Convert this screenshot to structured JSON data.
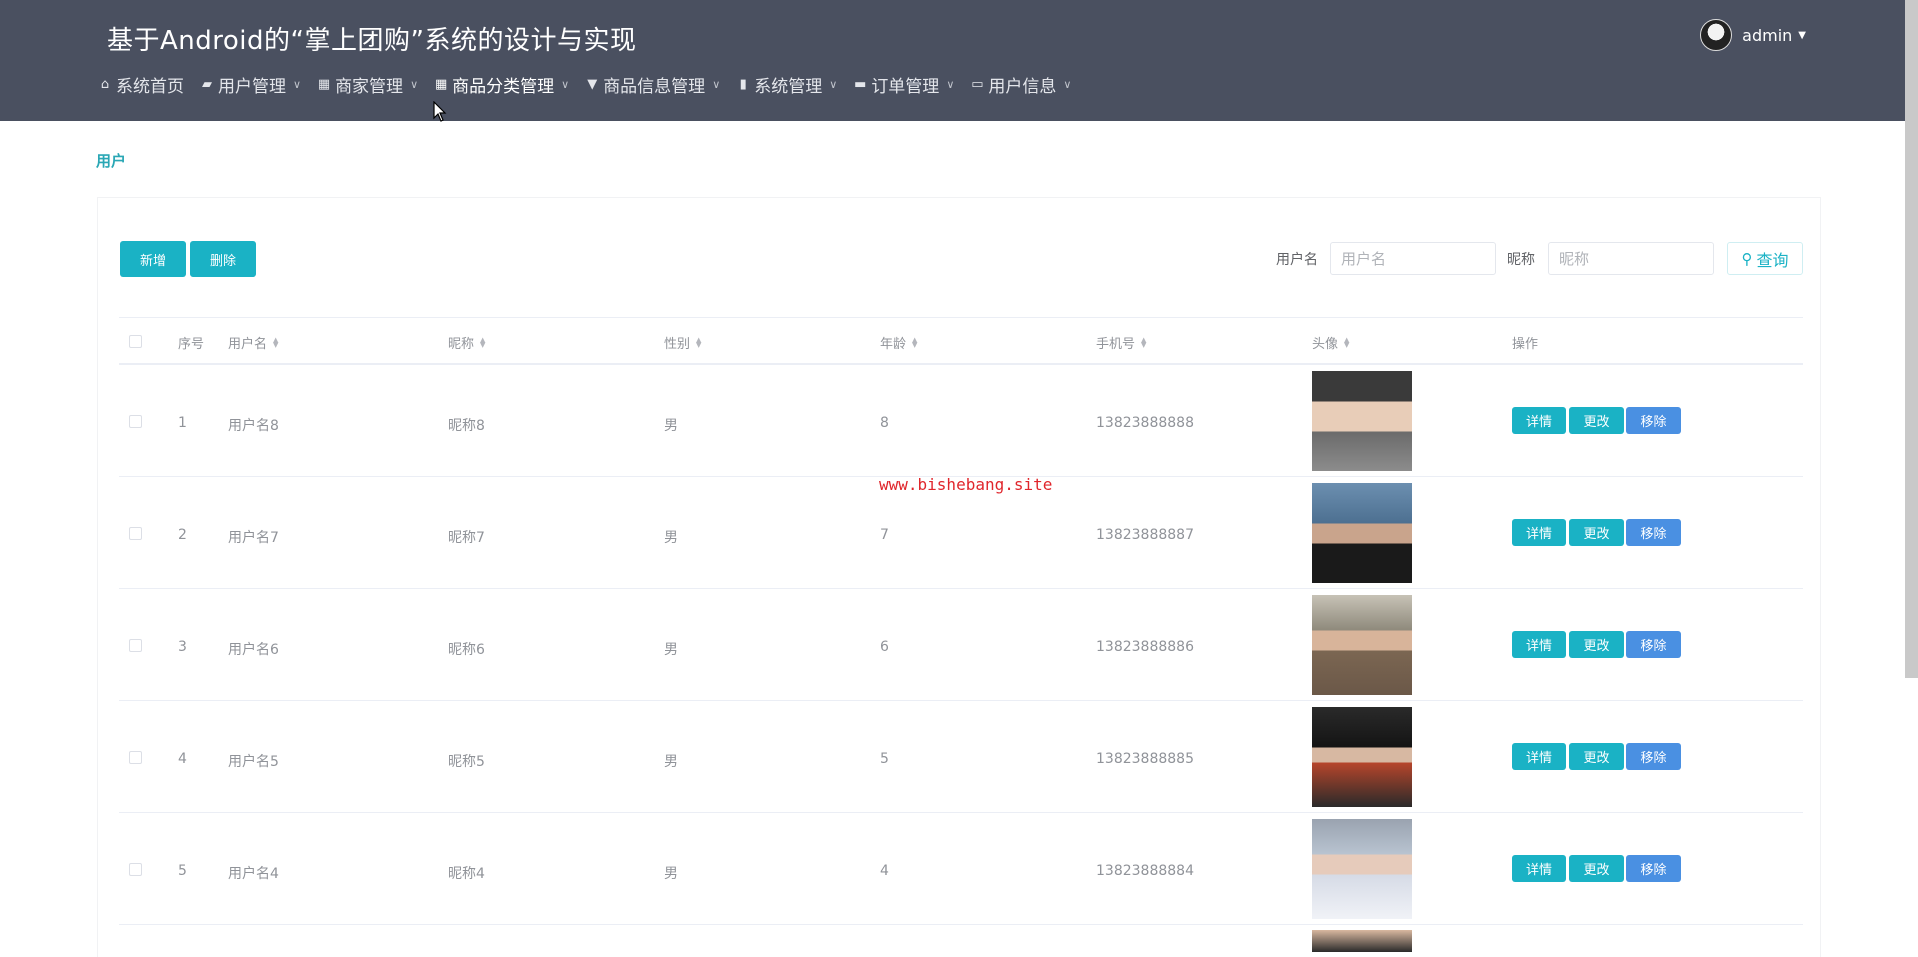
{
  "header": {
    "title": "基于Android的“掌上团购”系统的设计与实现",
    "user": "admin",
    "nav": [
      {
        "icon": "home-icon",
        "label": "系统首页"
      },
      {
        "icon": "user-manage-icon",
        "label": "用户管理"
      },
      {
        "icon": "grid-icon",
        "label": "商家管理"
      },
      {
        "icon": "grid-icon",
        "label": "商品分类管理"
      },
      {
        "icon": "pin-icon",
        "label": "商品信息管理"
      },
      {
        "icon": "book-icon",
        "label": "系统管理"
      },
      {
        "icon": "briefcase-icon",
        "label": "订单管理"
      },
      {
        "icon": "card-icon",
        "label": "用户信息"
      }
    ]
  },
  "breadcrumb": "用户",
  "toolbar": {
    "add_label": "新增",
    "delete_label": "删除",
    "username_label": "用户名",
    "username_placeholder": "用户名",
    "nickname_label": "昵称",
    "nickname_placeholder": "昵称",
    "query_label": "查询"
  },
  "table": {
    "headers": {
      "index": "序号",
      "username": "用户名",
      "nickname": "昵称",
      "gender": "性别",
      "age": "年龄",
      "phone": "手机号",
      "avatar": "头像",
      "action": "操作"
    },
    "rows": [
      {
        "index": "1",
        "username": "用户名8",
        "nickname": "昵称8",
        "gender": "男",
        "age": "8",
        "phone": "13823888888"
      },
      {
        "index": "2",
        "username": "用户名7",
        "nickname": "昵称7",
        "gender": "男",
        "age": "7",
        "phone": "13823888887"
      },
      {
        "index": "3",
        "username": "用户名6",
        "nickname": "昵称6",
        "gender": "男",
        "age": "6",
        "phone": "13823888886"
      },
      {
        "index": "4",
        "username": "用户名5",
        "nickname": "昵称5",
        "gender": "男",
        "age": "5",
        "phone": "13823888885"
      },
      {
        "index": "5",
        "username": "用户名4",
        "nickname": "昵称4",
        "gender": "男",
        "age": "4",
        "phone": "13823888884"
      }
    ],
    "actions": {
      "detail": "详情",
      "edit": "更改",
      "remove": "移除"
    }
  },
  "watermark": "www.bishebang.site",
  "colors": {
    "header": "#4a5060",
    "primary": "#1ab2c5",
    "remove": "#4a90e2"
  }
}
